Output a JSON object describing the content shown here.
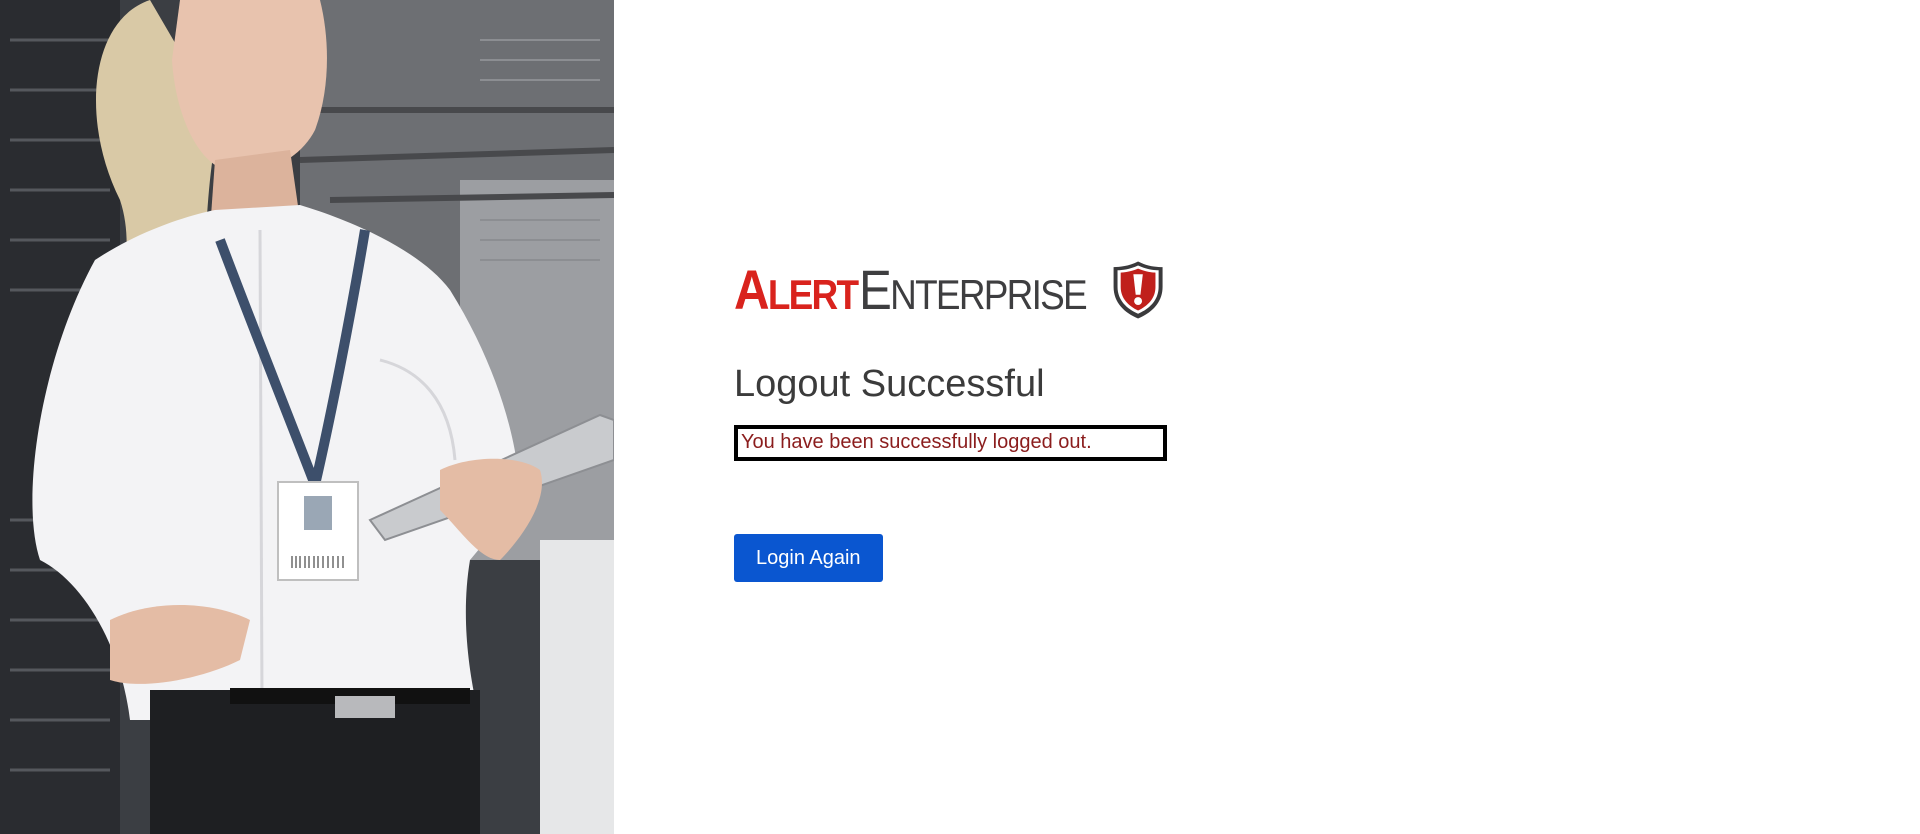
{
  "brand": {
    "alert_first": "A",
    "alert_rest": "LERT",
    "enterprise_first": "E",
    "enterprise_rest": "NTERPRISE",
    "colors": {
      "alert": "#d9231d",
      "enterprise": "#3e3e40",
      "shield": "#c0201c"
    }
  },
  "main": {
    "title": "Logout Successful",
    "message": "You have been successfully logged out.",
    "button_label": "Login Again",
    "colors": {
      "button": "#0a56d0",
      "message": "#8b1d1d"
    }
  },
  "hero": {
    "icon": "woman-with-tablet-photo"
  }
}
